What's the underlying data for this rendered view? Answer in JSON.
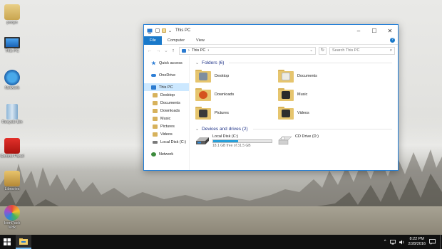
{
  "desktop": {
    "icons": [
      {
        "label": "pooyo",
        "icon": "user-folder-icon"
      },
      {
        "label": "This PC",
        "icon": "computer-icon"
      },
      {
        "label": "Network",
        "icon": "network-icon"
      },
      {
        "label": "Recycle Bin",
        "icon": "recycle-bin-icon"
      },
      {
        "label": "Control Panel",
        "icon": "control-panel-icon"
      },
      {
        "label": "Libraries",
        "icon": "libraries-icon"
      },
      {
        "label": "IconPack Mdk",
        "icon": "iconpack-icon"
      }
    ]
  },
  "window": {
    "title": "This PC",
    "controls": {
      "minimize": "–",
      "maximize": "☐",
      "close": "✕"
    },
    "ribbon": {
      "tabs": [
        "File",
        "Computer",
        "View"
      ],
      "help": "?"
    },
    "address": {
      "back": "←",
      "forward": "→",
      "recent": "⌄",
      "up": "↑",
      "path": "This PC",
      "sep": "›",
      "dropdown": "⌄",
      "refresh": "↻"
    },
    "search": {
      "placeholder": "Search This PC",
      "icon": "⌕"
    }
  },
  "nav": {
    "items": [
      {
        "label": "Quick access",
        "icon": "star-icon",
        "color": "#2f7fd6"
      },
      {
        "label": "OneDrive",
        "icon": "cloud-icon",
        "color": "#2f7fd6"
      },
      {
        "label": "This PC",
        "icon": "computer-icon",
        "color": "#2b7bd0",
        "selected": true
      },
      {
        "label": "Desktop",
        "icon": "desktop-folder-icon",
        "color": "#d7b25c"
      },
      {
        "label": "Documents",
        "icon": "documents-folder-icon",
        "color": "#d7b25c"
      },
      {
        "label": "Downloads",
        "icon": "downloads-folder-icon",
        "color": "#d7b25c"
      },
      {
        "label": "Music",
        "icon": "music-folder-icon",
        "color": "#d7b25c"
      },
      {
        "label": "Pictures",
        "icon": "pictures-folder-icon",
        "color": "#d7b25c"
      },
      {
        "label": "Videos",
        "icon": "videos-folder-icon",
        "color": "#d7b25c"
      },
      {
        "label": "Local Disk (C:)",
        "icon": "drive-icon",
        "color": "#7a7a7a"
      },
      {
        "label": "Network",
        "icon": "network-icon",
        "color": "#3d8b3d"
      }
    ]
  },
  "content": {
    "folders_header": "Folders (6)",
    "chevron": "⌄",
    "folders": [
      {
        "name": "Desktop",
        "icon": "desktop-folder-icon",
        "badge": "#7f8e9f"
      },
      {
        "name": "Documents",
        "icon": "documents-folder-icon",
        "badge": "#ecebe4"
      },
      {
        "name": "Downloads",
        "icon": "downloads-folder-icon",
        "badge": "#d5521f"
      },
      {
        "name": "Music",
        "icon": "music-folder-icon",
        "badge": "#2a2a2a"
      },
      {
        "name": "Pictures",
        "icon": "pictures-folder-icon",
        "badge": "#3a3a3a"
      },
      {
        "name": "Videos",
        "icon": "videos-folder-icon",
        "badge": "#2e2e2e"
      }
    ],
    "drives_header": "Devices and drives (2)",
    "drives": [
      {
        "name": "Local Disk (C:)",
        "free": "18.1 GB free of 31.5 GB",
        "used_fraction": 0.43,
        "icon": "hard-drive-icon",
        "show_bar": true
      },
      {
        "name": "CD Drive (D:)",
        "free": "",
        "icon": "cd-drive-icon",
        "show_bar": false
      }
    ]
  },
  "taskbar": {
    "time": "8:22 PM",
    "date": "2/28/2016",
    "tray_up": "^",
    "accent": "#76b9ed"
  }
}
